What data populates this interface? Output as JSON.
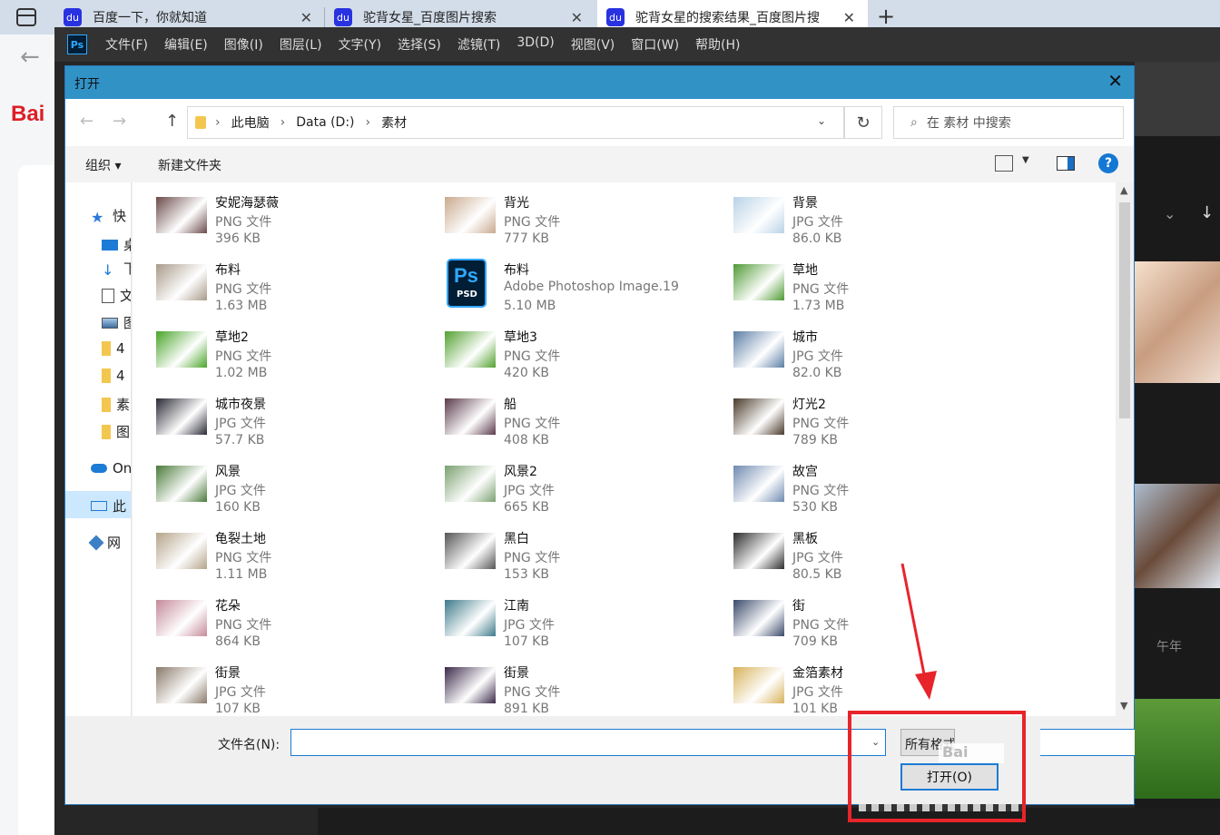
{
  "browser": {
    "tabs": [
      {
        "title": "百度一下，你就知道",
        "icon": "baidu-paw-icon"
      },
      {
        "title": "驼背女星_百度图片搜索",
        "icon": "baidu-paw-icon"
      },
      {
        "title": "驼背女星的搜索结果_百度图片搜",
        "icon": "baidu-paw-icon"
      }
    ],
    "logo_text": "Bai",
    "paw_glyph": "du"
  },
  "photoshop": {
    "app_icon": "Ps",
    "menu": [
      "文件(F)",
      "编辑(E)",
      "图像(I)",
      "图层(L)",
      "文字(Y)",
      "选择(S)",
      "滤镜(T)",
      "3D(D)",
      "视图(V)",
      "窗口(W)",
      "帮助(H)"
    ],
    "panel_text": "午年"
  },
  "dialog": {
    "title": "打开",
    "breadcrumb": [
      "此电脑",
      "Data (D:)",
      "素材"
    ],
    "search_placeholder": "在 素材 中搜索",
    "toolbar": {
      "organize": "组织 ▾",
      "new_folder": "新建文件夹"
    },
    "help_label": "?",
    "nav_items": [
      {
        "label": "快",
        "icon": "star-icon"
      },
      {
        "label": "桌",
        "icon": "desktop-icon"
      },
      {
        "label": "下",
        "icon": "download-icon"
      },
      {
        "label": "文",
        "icon": "document-icon"
      },
      {
        "label": "图",
        "icon": "picture-icon"
      },
      {
        "label": "4",
        "icon": "folder-icon"
      },
      {
        "label": "4",
        "icon": "folder-icon"
      },
      {
        "label": "素",
        "icon": "folder-icon"
      },
      {
        "label": "图",
        "icon": "folder-icon"
      },
      {
        "label": "On",
        "icon": "onedrive-icon"
      },
      {
        "label": "此",
        "icon": "pc-icon"
      },
      {
        "label": "网",
        "icon": "network-icon"
      }
    ],
    "files": [
      {
        "name": "安妮海瑟薇",
        "type": "PNG 文件",
        "size": "396 KB",
        "color": "#6b4a4a"
      },
      {
        "name": "背光",
        "type": "PNG 文件",
        "size": "777 KB",
        "color": "#c9a98e"
      },
      {
        "name": "背景",
        "type": "JPG 文件",
        "size": "86.0 KB",
        "color": "#b9d2e6"
      },
      {
        "name": "布料",
        "type": "PNG 文件",
        "size": "1.63 MB",
        "color": "#a99a8a"
      },
      {
        "name": "布料",
        "type": "Adobe Photoshop Image.19",
        "size": "5.10 MB",
        "color": "#001e36",
        "psd": true
      },
      {
        "name": "草地",
        "type": "PNG 文件",
        "size": "1.73 MB",
        "color": "#4f9a34"
      },
      {
        "name": "草地2",
        "type": "PNG 文件",
        "size": "1.02 MB",
        "color": "#48a528"
      },
      {
        "name": "草地3",
        "type": "PNG 文件",
        "size": "420 KB",
        "color": "#52a12f"
      },
      {
        "name": "城市",
        "type": "JPG 文件",
        "size": "82.0 KB",
        "color": "#5c7ea6"
      },
      {
        "name": "城市夜景",
        "type": "JPG 文件",
        "size": "57.7 KB",
        "color": "#2a2a36"
      },
      {
        "name": "船",
        "type": "PNG 文件",
        "size": "408 KB",
        "color": "#5a3a4a"
      },
      {
        "name": "灯光2",
        "type": "PNG 文件",
        "size": "789 KB",
        "color": "#4a3a2a"
      },
      {
        "name": "风景",
        "type": "JPG 文件",
        "size": "160 KB",
        "color": "#4a7a3a"
      },
      {
        "name": "风景2",
        "type": "JPG 文件",
        "size": "665 KB",
        "color": "#7aa070"
      },
      {
        "name": "故宫",
        "type": "PNG 文件",
        "size": "530 KB",
        "color": "#6f8ab0"
      },
      {
        "name": "龟裂土地",
        "type": "PNG 文件",
        "size": "1.11 MB",
        "color": "#b5a48a"
      },
      {
        "name": "黑白",
        "type": "PNG 文件",
        "size": "153 KB",
        "color": "#555555"
      },
      {
        "name": "黑板",
        "type": "JPG 文件",
        "size": "80.5 KB",
        "color": "#2d2d2d"
      },
      {
        "name": "花朵",
        "type": "PNG 文件",
        "size": "864 KB",
        "color": "#c58a9a"
      },
      {
        "name": "江南",
        "type": "JPG 文件",
        "size": "107 KB",
        "color": "#3d7a8a"
      },
      {
        "name": "街",
        "type": "PNG 文件",
        "size": "709 KB",
        "color": "#3a4a6a"
      },
      {
        "name": "街景",
        "type": "JPG 文件",
        "size": "107 KB",
        "color": "#8a7a6a"
      },
      {
        "name": "街景",
        "type": "PNG 文件",
        "size": "891 KB",
        "color": "#3a2a4a"
      },
      {
        "name": "金箔素材",
        "type": "JPG 文件",
        "size": "101 KB",
        "color": "#d7b25a"
      }
    ],
    "filename_label": "文件名(N):",
    "filename_value": "",
    "filter_label": "所有格式",
    "watermark_text": "Bai",
    "open_button": "打开(O)",
    "close_glyph": "✕"
  },
  "colors": {
    "titlebar": "#3192c6",
    "annotation": "#e8242b",
    "accent": "#1c7bd4"
  }
}
